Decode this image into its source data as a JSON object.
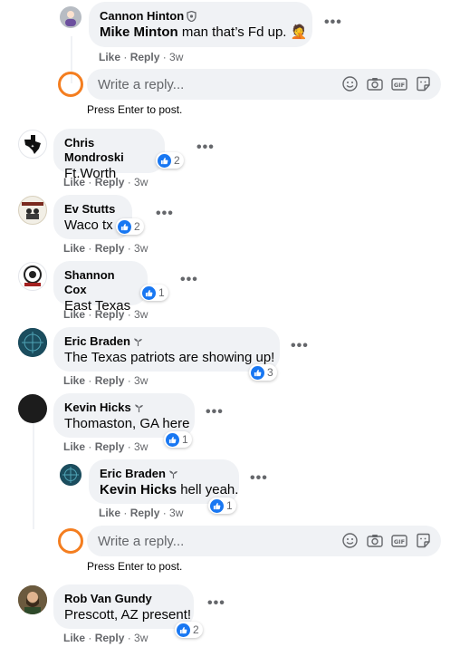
{
  "comments": [
    {
      "id": "cannon",
      "name": "Cannon Hinton",
      "badge": "shield",
      "mention": "Mike Minton",
      "text": " man that’s Fd up. 🤦",
      "time": "3w",
      "reactions": null
    },
    {
      "id": "chris",
      "name": "Chris Mondroski",
      "badge": null,
      "mention": null,
      "text": "Ft.Worth",
      "time": "3w",
      "reactions": "2"
    },
    {
      "id": "ev",
      "name": "Ev Stutts",
      "badge": null,
      "mention": null,
      "text": "Waco tx",
      "time": "3w",
      "reactions": "2"
    },
    {
      "id": "shannon",
      "name": "Shannon Cox",
      "badge": null,
      "mention": null,
      "text": "East Texas",
      "time": "3w",
      "reactions": "1"
    },
    {
      "id": "eric",
      "name": "Eric Braden",
      "badge": "sprout",
      "mention": null,
      "text": "The Texas patriots are showing up!",
      "time": "3w",
      "reactions": "3"
    },
    {
      "id": "kevin",
      "name": "Kevin Hicks",
      "badge": "sprout",
      "mention": null,
      "text": "Thomaston, GA here",
      "time": "3w",
      "reactions": "1"
    },
    {
      "id": "eric2",
      "name": "Eric Braden",
      "badge": "sprout",
      "mention": "Kevin Hicks",
      "text": " hell yeah.",
      "time": "3w",
      "reactions": "1"
    },
    {
      "id": "rob",
      "name": "Rob Van Gundy",
      "badge": null,
      "mention": null,
      "text": "Prescott, AZ present!",
      "time": "3w",
      "reactions": "2"
    }
  ],
  "actions": {
    "like": "Like",
    "reply": "Reply",
    "separator": "·"
  },
  "reply_box": {
    "placeholder": "Write a reply...",
    "hint": "Press Enter to post."
  },
  "icons": [
    "emoji-icon",
    "camera-icon",
    "gif-icon",
    "sticker-icon"
  ],
  "colors": {
    "bubble": "#f0f2f5",
    "meta": "#65676b",
    "like_blue": "#1877f2",
    "ring": "#f47e20"
  }
}
